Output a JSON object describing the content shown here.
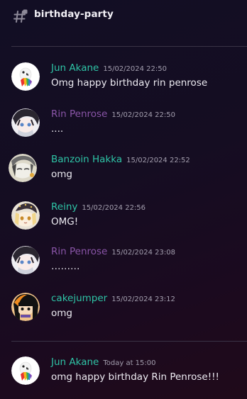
{
  "channel": {
    "name": "birthday-party",
    "icon": "hash-thread-icon"
  },
  "colors": {
    "teal_author": "#2ec4a6",
    "purple_author": "#8a55a8",
    "timestamp": "#a39eae"
  },
  "messages": [
    {
      "author": "Jun Akane",
      "timestamp": "15/02/2024 22:50",
      "content": "Omg happy birthday rin penrose",
      "avatar": "parrot-avatar",
      "author_color": "teal"
    },
    {
      "author": "Rin Penrose",
      "timestamp": "15/02/2024 22:50",
      "content": "....",
      "avatar": "anime-girl-avatar",
      "author_color": "purple"
    },
    {
      "author": "Banzoin Hakka",
      "timestamp": "15/02/2024 22:52",
      "content": "omg",
      "avatar": "monochrome-anime-avatar",
      "author_color": "teal"
    },
    {
      "author": "Reiny",
      "timestamp": "15/02/2024 22:56",
      "content": "OMG!",
      "avatar": "blonde-anime-avatar",
      "author_color": "teal"
    },
    {
      "author": "Rin Penrose",
      "timestamp": "15/02/2024 23:08",
      "content": "………",
      "avatar": "anime-girl-avatar",
      "author_color": "purple"
    },
    {
      "author": "cakejumper",
      "timestamp": "15/02/2024 23:12",
      "content": "omg",
      "avatar": "orange-hair-avatar",
      "author_color": "teal"
    },
    {
      "author": "Jun Akane",
      "timestamp": "Today at 15:00",
      "content": "omg happy birthday Rin Penrose!!!",
      "avatar": "parrot-avatar",
      "author_color": "teal"
    }
  ]
}
